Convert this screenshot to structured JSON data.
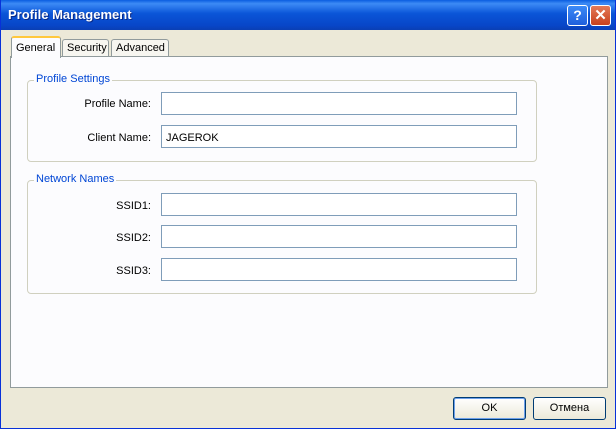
{
  "window": {
    "title": "Profile Management",
    "help_glyph": "?",
    "close_glyph": "✕"
  },
  "tabs": [
    {
      "label": "General",
      "active": true
    },
    {
      "label": "Security",
      "active": false
    },
    {
      "label": "Advanced",
      "active": false
    }
  ],
  "profile_settings": {
    "legend": "Profile Settings",
    "profile_name_label": "Profile Name:",
    "profile_name_value": "",
    "client_name_label": "Client Name:",
    "client_name_value": "JAGEROK"
  },
  "network_names": {
    "legend": "Network Names",
    "ssid1_label": "SSID1:",
    "ssid1_value": "",
    "ssid2_label": "SSID2:",
    "ssid2_value": "",
    "ssid3_label": "SSID3:",
    "ssid3_value": ""
  },
  "buttons": {
    "ok": "OK",
    "cancel": "Отмена"
  },
  "colors": {
    "titlebar": "#0a55d8",
    "group_legend": "#0046d5",
    "active_tab_accent": "#ffc83c"
  }
}
